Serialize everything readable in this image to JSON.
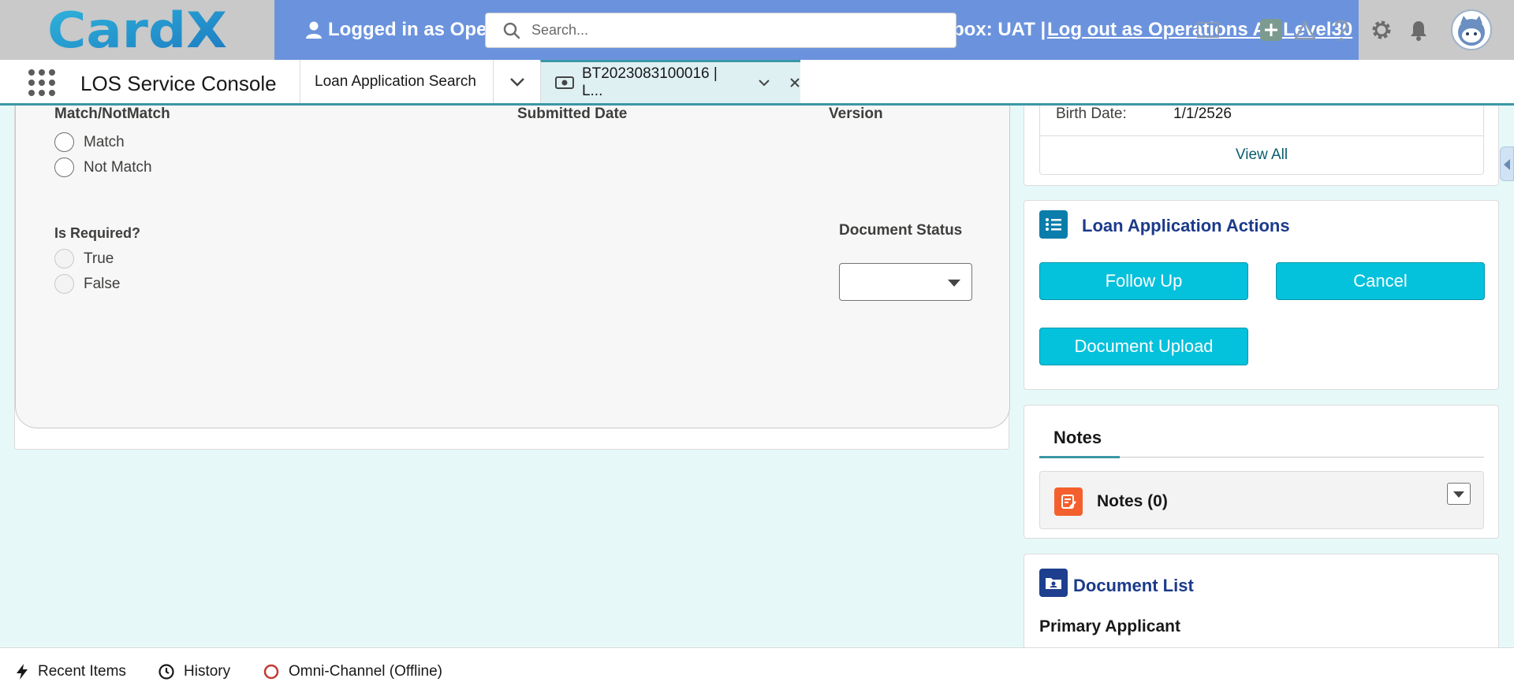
{
  "header": {
    "logo_text": "CardX",
    "logged_in_text": "Logged in as Opera",
    "sandbox_text": "box: UAT |",
    "logout_text": "Log out as Operations Au Level30",
    "search_placeholder": "Search..."
  },
  "appnav": {
    "app_name": "LOS Service Console",
    "tabs": [
      {
        "label": "Loan Application Search"
      },
      {
        "label": "BT2023083100016 | L..."
      }
    ]
  },
  "detail": {
    "match_label": "Match/NotMatch",
    "match_options": [
      "Match",
      "Not Match"
    ],
    "submitted_date_label": "Submitted Date",
    "version_label": "Version",
    "is_required_label": "Is Required?",
    "is_required_options": [
      "True",
      "False"
    ],
    "document_status_label": "Document Status",
    "document_status_value": ""
  },
  "applicant": {
    "birth_date_label": "Birth Date:",
    "birth_date_value": "1/1/2526",
    "view_all": "View All"
  },
  "actions": {
    "title": "Loan Application Actions",
    "buttons": [
      "Follow Up",
      "Cancel",
      "Document Upload"
    ]
  },
  "notes": {
    "tab_label": "Notes",
    "list_label": "Notes (0)"
  },
  "document_list": {
    "title": "Document List",
    "section": "Primary Applicant"
  },
  "utility_bar": {
    "items": [
      "Recent Items",
      "History",
      "Omni-Channel (Offline)"
    ]
  },
  "colors": {
    "banner": "#6b93dd",
    "button": "#04c1dc",
    "accent": "#3b97a6",
    "background": "#e6f9f8",
    "notes_icon": "#f4602d"
  }
}
